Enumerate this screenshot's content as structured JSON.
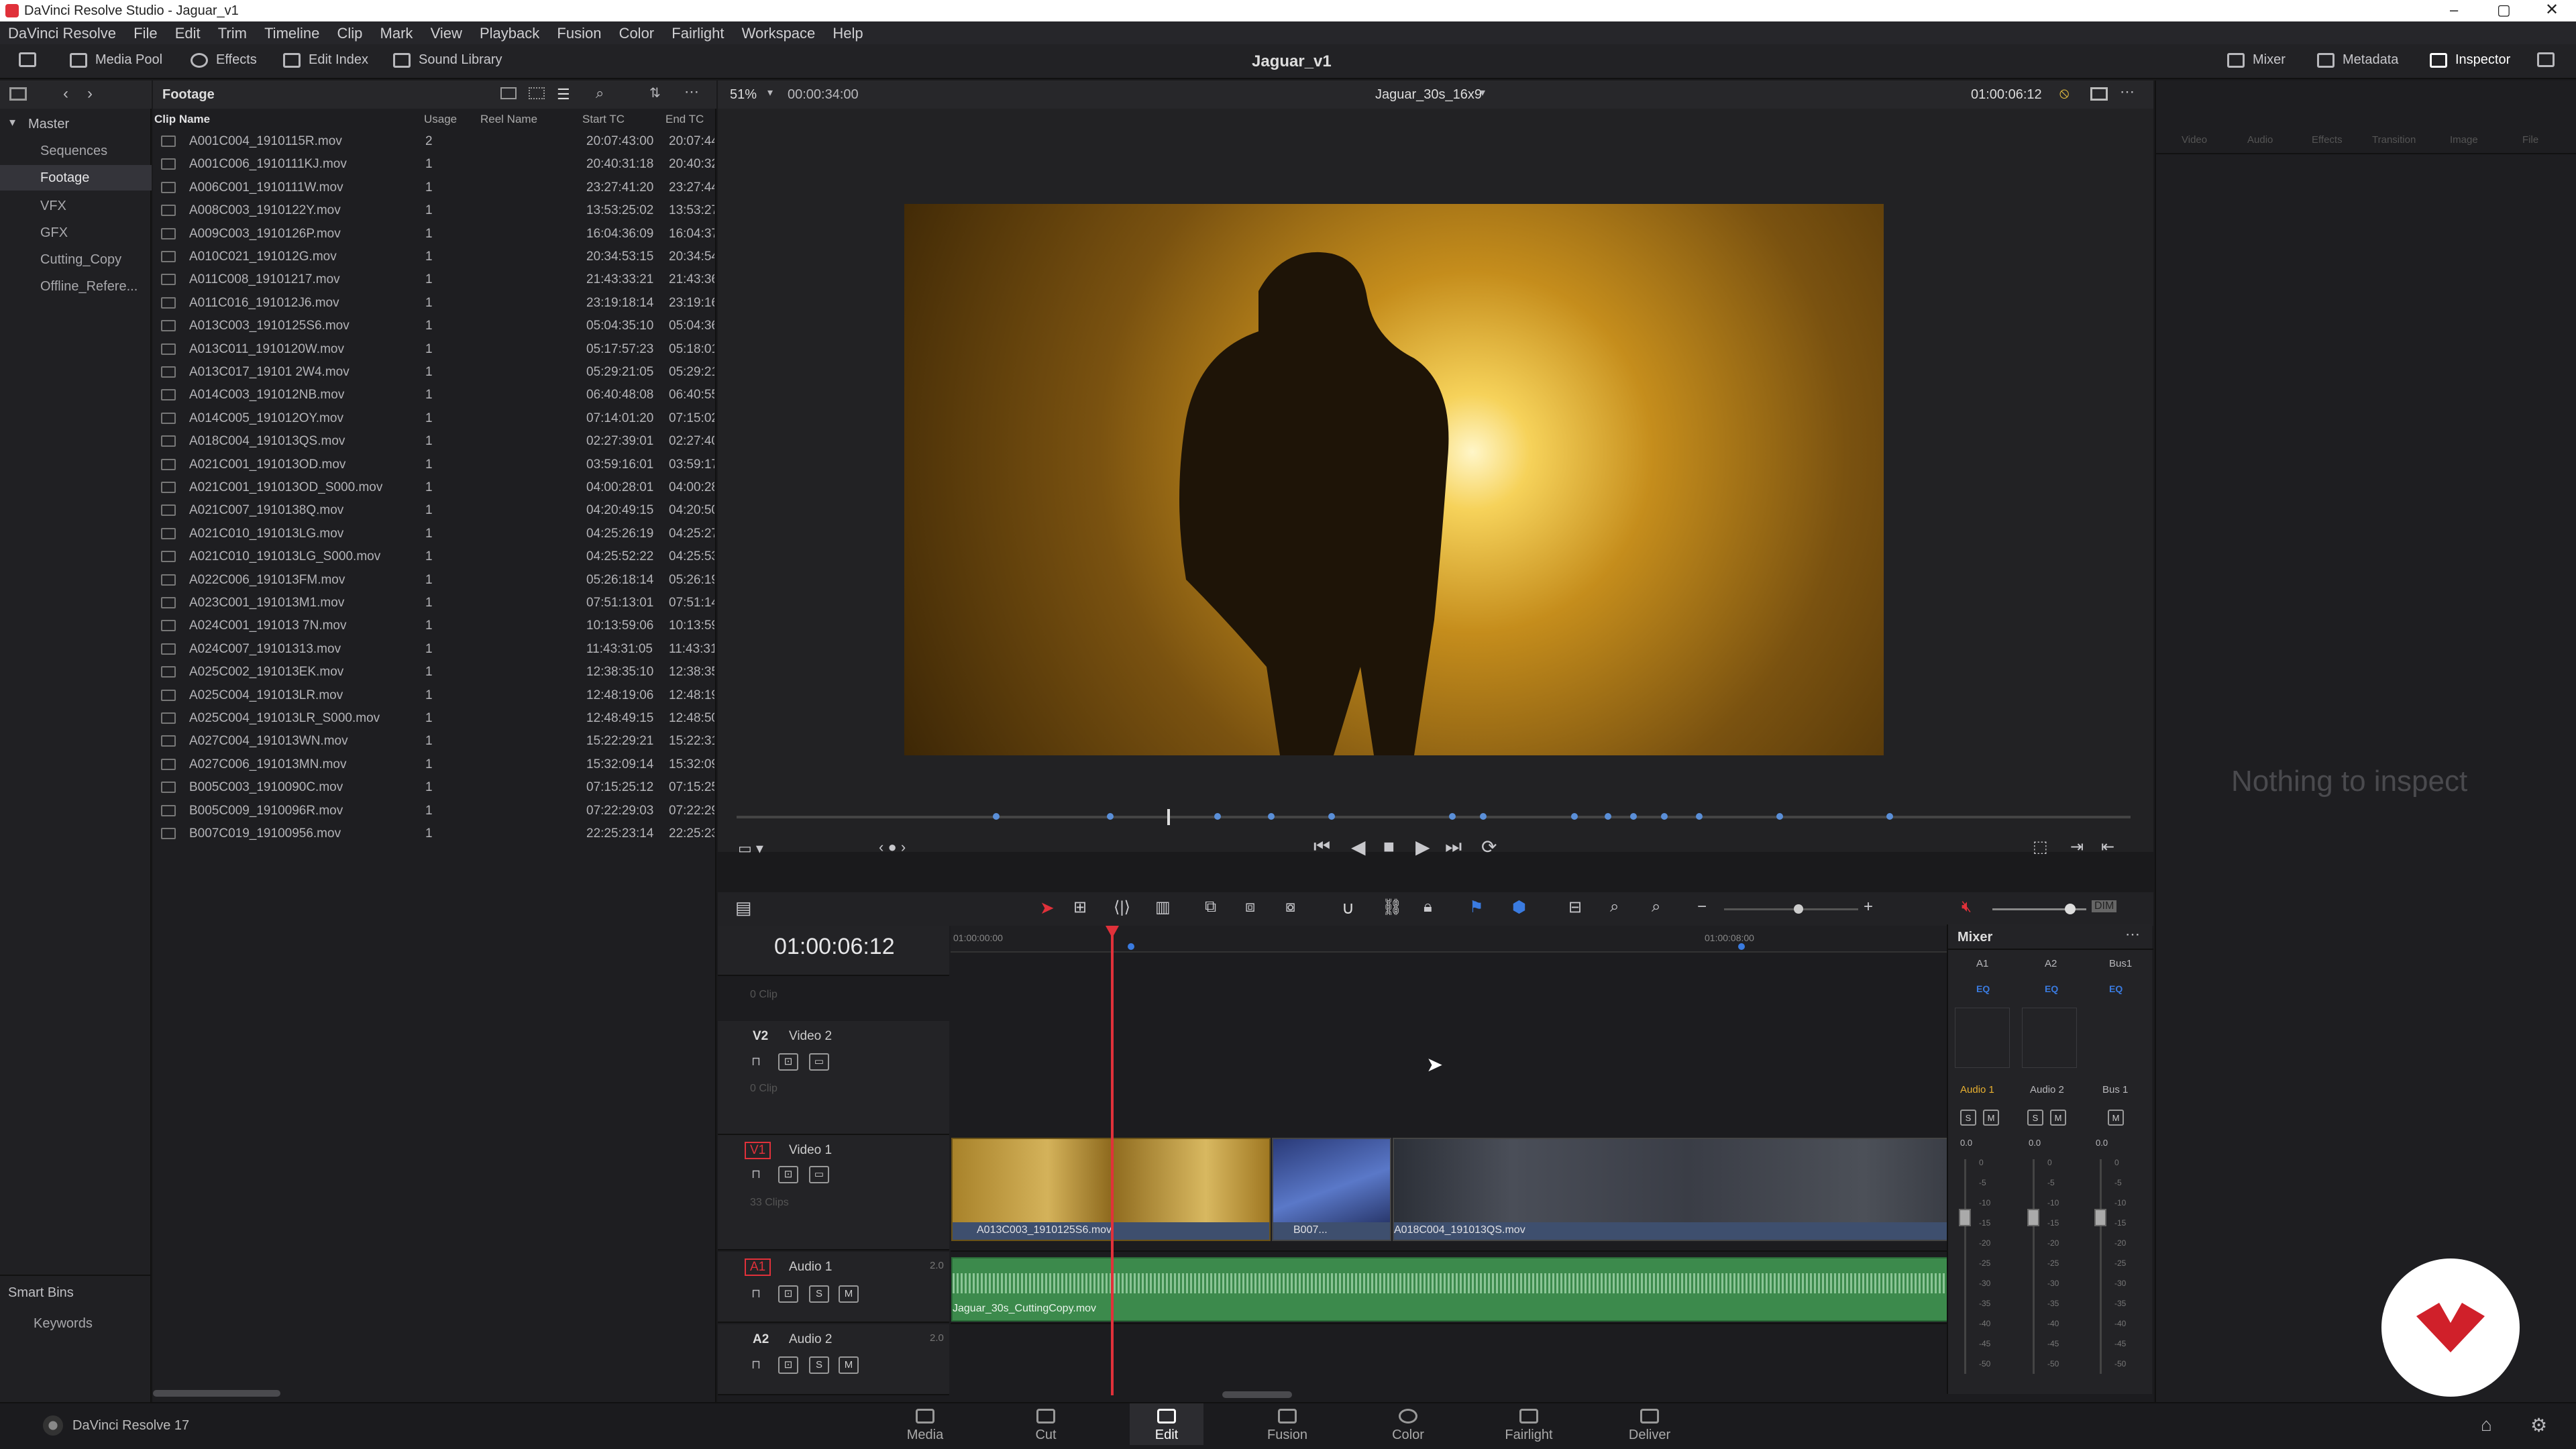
{
  "titlebar": {
    "title": "DaVinci Resolve Studio - Jaguar_v1"
  },
  "menu": [
    "DaVinci Resolve",
    "File",
    "Edit",
    "Trim",
    "Timeline",
    "Clip",
    "Mark",
    "View",
    "Playback",
    "Fusion",
    "Color",
    "Fairlight",
    "Workspace",
    "Help"
  ],
  "toolbar": {
    "media_pool": "Media Pool",
    "effects": "Effects",
    "edit_index": "Edit Index",
    "sound_library": "Sound Library",
    "project_title": "Jaguar_v1",
    "mixer": "Mixer",
    "metadata": "Metadata",
    "inspector": "Inspector"
  },
  "sidebar": {
    "master": "Master",
    "bins": [
      "Sequences",
      "Footage",
      "VFX",
      "GFX",
      "Cutting_Copy",
      "Offline_Refere..."
    ],
    "selected_bin": "Footage",
    "smart_bins": "Smart Bins",
    "keywords": "Keywords"
  },
  "pool": {
    "title": "Footage",
    "columns": {
      "name": "Clip Name",
      "usage": "Usage",
      "reel": "Reel Name",
      "start": "Start TC",
      "end": "End TC"
    },
    "clips": [
      {
        "name": "A001C004_1910115R.mov",
        "usage": "2",
        "start": "20:07:43:00",
        "end": "20:07:44"
      },
      {
        "name": "A001C006_1910111KJ.mov",
        "usage": "1",
        "start": "20:40:31:18",
        "end": "20:40:32"
      },
      {
        "name": "A006C001_1910111W.mov",
        "usage": "1",
        "start": "23:27:41:20",
        "end": "23:27:44"
      },
      {
        "name": "A008C003_1910122Y.mov",
        "usage": "1",
        "start": "13:53:25:02",
        "end": "13:53:27"
      },
      {
        "name": "A009C003_1910126P.mov",
        "usage": "1",
        "start": "16:04:36:09",
        "end": "16:04:37"
      },
      {
        "name": "A010C021_191012G.mov",
        "usage": "1",
        "start": "20:34:53:15",
        "end": "20:34:54"
      },
      {
        "name": "A011C008_19101217.mov",
        "usage": "1",
        "start": "21:43:33:21",
        "end": "21:43:36"
      },
      {
        "name": "A011C016_191012J6.mov",
        "usage": "1",
        "start": "23:19:18:14",
        "end": "23:19:16"
      },
      {
        "name": "A013C003_1910125S6.mov",
        "usage": "1",
        "start": "05:04:35:10",
        "end": "05:04:36"
      },
      {
        "name": "A013C011_1910120W.mov",
        "usage": "1",
        "start": "05:17:57:23",
        "end": "05:18:01"
      },
      {
        "name": "A013C017_19101 2W4.mov",
        "usage": "1",
        "start": "05:29:21:05",
        "end": "05:29:21"
      },
      {
        "name": "A014C003_191012NB.mov",
        "usage": "1",
        "start": "06:40:48:08",
        "end": "06:40:55"
      },
      {
        "name": "A014C005_191012OY.mov",
        "usage": "1",
        "start": "07:14:01:20",
        "end": "07:15:02"
      },
      {
        "name": "A018C004_191013QS.mov",
        "usage": "1",
        "start": "02:27:39:01",
        "end": "02:27:40"
      },
      {
        "name": "A021C001_191013OD.mov",
        "usage": "1",
        "start": "03:59:16:01",
        "end": "03:59:17"
      },
      {
        "name": "A021C001_191013OD_S000.mov",
        "usage": "1",
        "start": "04:00:28:01",
        "end": "04:00:28"
      },
      {
        "name": "A021C007_1910138Q.mov",
        "usage": "1",
        "start": "04:20:49:15",
        "end": "04:20:50"
      },
      {
        "name": "A021C010_191013LG.mov",
        "usage": "1",
        "start": "04:25:26:19",
        "end": "04:25:27"
      },
      {
        "name": "A021C010_191013LG_S000.mov",
        "usage": "1",
        "start": "04:25:52:22",
        "end": "04:25:53"
      },
      {
        "name": "A022C006_191013FM.mov",
        "usage": "1",
        "start": "05:26:18:14",
        "end": "05:26:19"
      },
      {
        "name": "A023C001_191013M1.mov",
        "usage": "1",
        "start": "07:51:13:01",
        "end": "07:51:14"
      },
      {
        "name": "A024C001_191013 7N.mov",
        "usage": "1",
        "start": "10:13:59:06",
        "end": "10:13:59"
      },
      {
        "name": "A024C007_19101313.mov",
        "usage": "1",
        "start": "11:43:31:05",
        "end": "11:43:31"
      },
      {
        "name": "A025C002_191013EK.mov",
        "usage": "1",
        "start": "12:38:35:10",
        "end": "12:38:35"
      },
      {
        "name": "A025C004_191013LR.mov",
        "usage": "1",
        "start": "12:48:19:06",
        "end": "12:48:19"
      },
      {
        "name": "A025C004_191013LR_S000.mov",
        "usage": "1",
        "start": "12:48:49:15",
        "end": "12:48:50"
      },
      {
        "name": "A027C004_191013WN.mov",
        "usage": "1",
        "start": "15:22:29:21",
        "end": "15:22:31"
      },
      {
        "name": "A027C006_191013MN.mov",
        "usage": "1",
        "start": "15:32:09:14",
        "end": "15:32:09"
      },
      {
        "name": "B005C003_1910090C.mov",
        "usage": "1",
        "start": "07:15:25:12",
        "end": "07:15:25"
      },
      {
        "name": "B005C009_1910096R.mov",
        "usage": "1",
        "start": "07:22:29:03",
        "end": "07:22:29"
      },
      {
        "name": "B007C019_19100956.mov",
        "usage": "1",
        "start": "22:25:23:14",
        "end": "22:25:23"
      }
    ]
  },
  "viewer": {
    "zoom": "51%",
    "duration": "00:00:34:00",
    "timeline_name": "Jaguar_30s_16x9",
    "timecode": "01:00:06:12"
  },
  "inspector": {
    "empty_text": "Nothing to inspect",
    "tabs": [
      "Video",
      "Audio",
      "Effects",
      "Transition",
      "Image",
      "File"
    ]
  },
  "timeline": {
    "timecode": "01:00:06:12",
    "ruler_start": "01:00:00:00",
    "ruler_mid": "01:00:08:00",
    "empty_clip": "0 Clip",
    "tracks": {
      "v2": {
        "id": "V2",
        "name": "Video 2",
        "clips": "0 Clip"
      },
      "v1": {
        "id": "V1",
        "name": "Video 1",
        "clips": "33 Clips"
      },
      "a1": {
        "id": "A1",
        "name": "Audio 1",
        "ch": "2.0"
      },
      "a2": {
        "id": "A2",
        "name": "Audio 2",
        "ch": "2.0"
      }
    },
    "clip_labels": {
      "c1": "A013C003_1910125S6.mov",
      "c2": "B007...",
      "c3": "A018C004_191013QS.mov",
      "audio": "Jaguar_30s_CuttingCopy.mov"
    }
  },
  "mixer": {
    "title": "Mixer",
    "channels": [
      "A1",
      "A2",
      "Bus1"
    ],
    "eq": "EQ",
    "strip_names": [
      "Audio 1",
      "Audio 2",
      "Bus 1"
    ],
    "solo": "S",
    "mute": "M",
    "level": "0.0",
    "scale": [
      "0",
      "-5",
      "-10",
      "-15",
      "-20",
      "-25",
      "-30",
      "-35",
      "-40",
      "-45",
      "-50"
    ]
  },
  "bottom": {
    "app": "DaVinci Resolve 17",
    "pages": [
      "Media",
      "Cut",
      "Edit",
      "Fusion",
      "Color",
      "Fairlight",
      "Deliver"
    ],
    "active_page": "Edit"
  },
  "colors": {
    "accent_red": "#e0313a",
    "audio_green": "#3c8a4c",
    "video_gold": "#c49a2a",
    "playhead": "#e0313a"
  }
}
